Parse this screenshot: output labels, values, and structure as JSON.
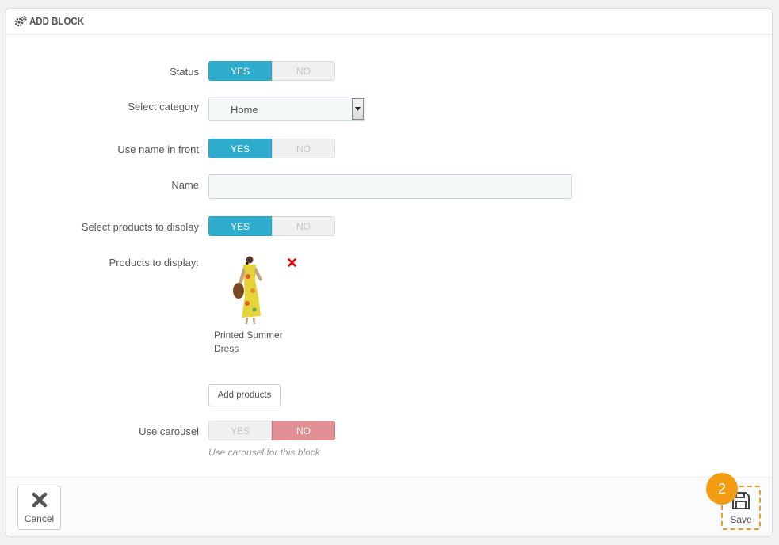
{
  "panel": {
    "title": "ADD BLOCK",
    "icon": "gears-icon"
  },
  "form": {
    "status": {
      "label": "Status",
      "yes": "YES",
      "no": "NO",
      "value": "yes"
    },
    "category": {
      "label": "Select category",
      "value": "Home"
    },
    "use_name": {
      "label": "Use name in front",
      "yes": "YES",
      "no": "NO",
      "value": "yes"
    },
    "name": {
      "label": "Name",
      "value": ""
    },
    "select_products": {
      "label": "Select products to display",
      "yes": "YES",
      "no": "NO",
      "value": "yes"
    },
    "products": {
      "label": "Products to display:",
      "items": [
        {
          "name": "Printed Summer Dress"
        }
      ],
      "add_button": "Add products"
    },
    "carousel": {
      "label": "Use carousel",
      "yes": "YES",
      "no": "NO",
      "value": "no",
      "help": "Use carousel for this block"
    }
  },
  "footer": {
    "cancel": "Cancel",
    "save": "Save"
  },
  "step_badge": "2",
  "colors": {
    "accent": "#2eacce",
    "danger": "#e08f95",
    "badge": "#f39c12"
  }
}
